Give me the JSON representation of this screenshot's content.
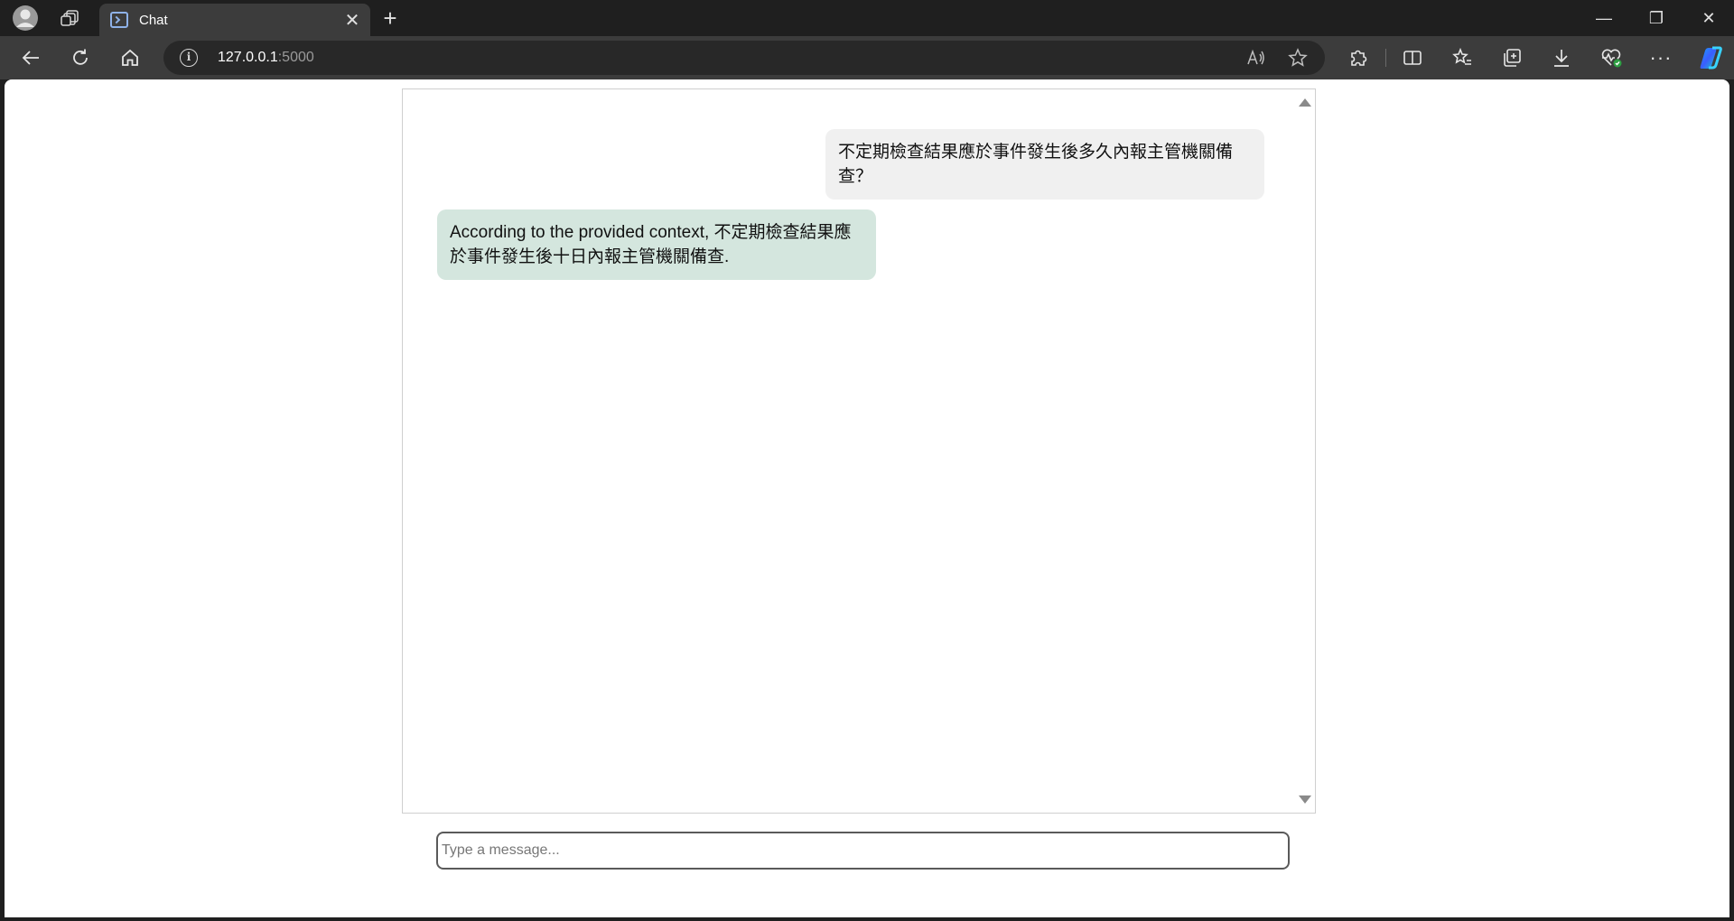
{
  "browser": {
    "tab_title": "Chat",
    "tab_close": "✕",
    "new_tab": "+",
    "url_host": "127.0.0.1",
    "url_port": ":5000",
    "window_controls": {
      "minimize": "—",
      "restore": "❐",
      "close": "✕"
    }
  },
  "icons": {
    "profile": "profile-icon",
    "workspaces": "workspaces-icon",
    "back": "back-arrow-icon",
    "refresh": "refresh-icon",
    "home": "home-icon",
    "info": "info-icon",
    "read_aloud": "read-aloud-icon",
    "favorite": "star-icon",
    "extensions": "puzzle-icon",
    "split_screen": "split-screen-icon",
    "favorites": "favorites-icon",
    "collections": "collections-icon",
    "downloads": "download-icon",
    "browser_essentials": "heart-pulse-icon",
    "more": "more-icon",
    "copilot": "copilot-icon"
  },
  "chat": {
    "messages": [
      {
        "role": "user",
        "text": "不定期檢查結果應於事件發生後多久內報主管機關備查？"
      },
      {
        "role": "assistant",
        "text": "According to the provided context, 不定期檢查結果應於事件發生後十日內報主管機關備查."
      }
    ],
    "input_placeholder": "Type a message..."
  },
  "colors": {
    "user_bubble": "#f0f0f0",
    "assistant_bubble": "#d4e6de"
  }
}
